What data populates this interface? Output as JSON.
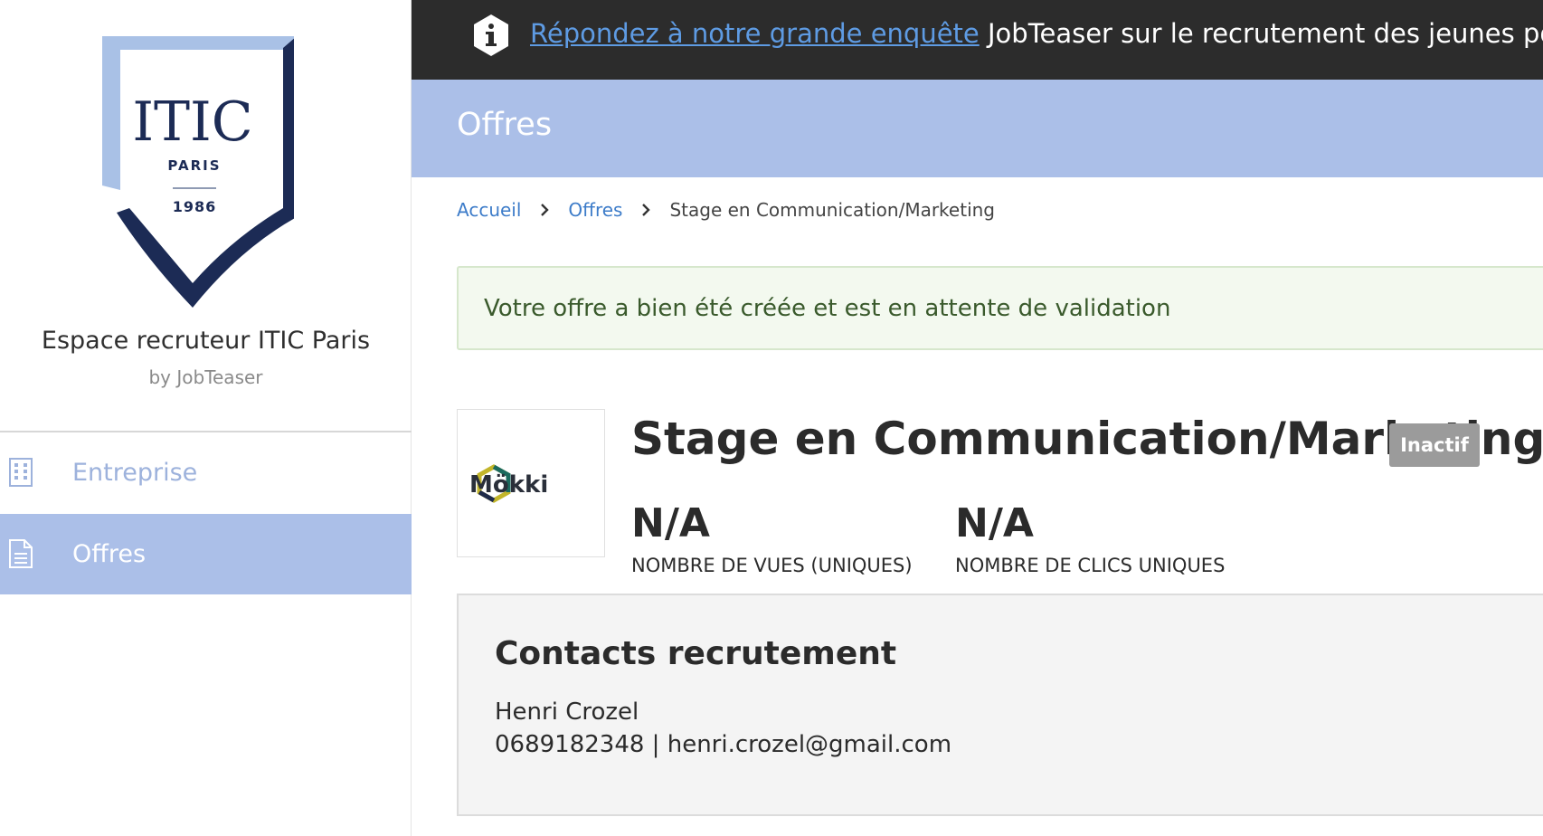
{
  "sidebar": {
    "logo": {
      "name": "ITIC",
      "city": "PARIS",
      "year": "1986",
      "colors": {
        "navy": "#1c2b55",
        "light_blue": "#a9c1e6"
      }
    },
    "title": "Espace recruteur ITIC Paris",
    "subtitle": "by JobTeaser",
    "nav": [
      {
        "label": "Entreprise",
        "icon": "building-icon",
        "active": false
      },
      {
        "label": "Offres",
        "icon": "document-icon",
        "active": true
      }
    ]
  },
  "topbar": {
    "icon": "info-icon",
    "link_text": "Répondez à notre grande enquête",
    "rest_text": " JobTeaser sur le recrutement des jeunes pour appr"
  },
  "header": {
    "title": "Offres"
  },
  "breadcrumb": {
    "items": [
      "Accueil",
      "Offres"
    ],
    "current": "Stage en Communication/Marketing"
  },
  "alert": {
    "message": "Votre offre a bien été créée et est en attente de validation"
  },
  "offer": {
    "company_logo_text": "Mökki",
    "title": "Stage en Communication/Marketing",
    "status": "Inactif",
    "stats": [
      {
        "value": "N/A",
        "label": "NOMBRE DE VUES (UNIQUES)"
      },
      {
        "value": "N/A",
        "label": "NOMBRE DE CLICS UNIQUES"
      }
    ]
  },
  "contacts": {
    "title": "Contacts recrutement",
    "name": "Henri Crozel",
    "phone": "0689182348",
    "separator": " | ",
    "email": "henri.crozel@gmail.com"
  },
  "colors": {
    "accent": "#abbfe8",
    "link": "#3d7cc9",
    "topbar": "#2c2c2c",
    "success_bg": "#f3f9ef",
    "badge": "#9b9b9b"
  }
}
